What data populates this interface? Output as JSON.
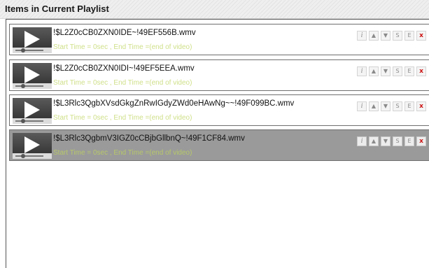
{
  "header": {
    "title": "Items in Current Playlist"
  },
  "playlist": {
    "items": [
      {
        "name": "!$L2Z0cCB0ZXN0IDE~!49EF556B.wmv",
        "time": "Start Time = 0sec , End Time =(end of video)"
      },
      {
        "name": "!$L2Z0cCB0ZXN0IDI~!49EF5EEA.wmv",
        "time": "Start Time = 0sec , End Time =(end of video)"
      },
      {
        "name": "!$L3Rlc3QgbXVsdGkgZnRwIGdyZWd0eHAwNg~~!49F099BC.wmv",
        "time": "Start Time = 0sec , End Time =(end of video)"
      },
      {
        "name": "!$L3Rlc3QgbmV3IGZ0cCBjbGllbnQ~!49F1CF84.wmv",
        "time": "Start Time = 0sec , End Time =(end of video)",
        "selected": true
      }
    ],
    "controls": {
      "info": "i",
      "up": "▲",
      "down": "▼",
      "start": "S",
      "end": "E",
      "remove": "x"
    }
  },
  "colors": {
    "time_text": "#cfe08a",
    "remove": "#cc1111",
    "selected_row": "#9a9a9a"
  }
}
